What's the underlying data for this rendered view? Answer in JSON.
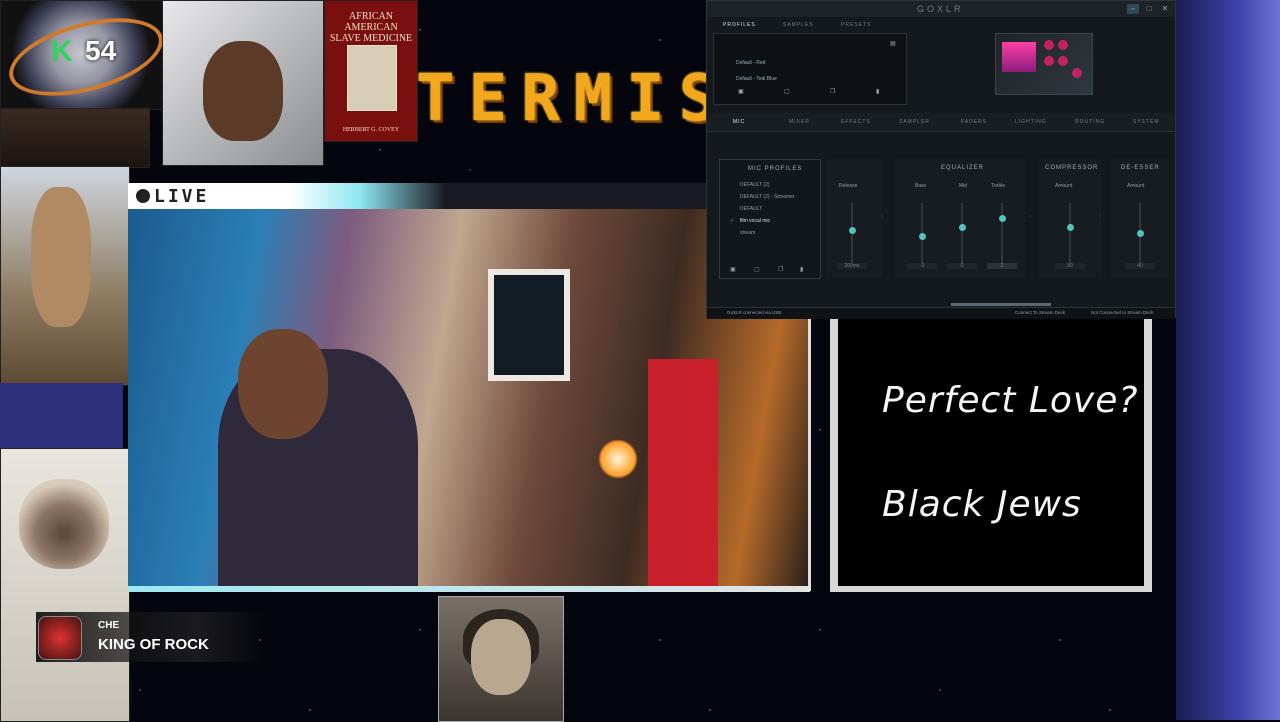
{
  "overlay": {
    "kick_letter": "K",
    "kick_count": "54",
    "ticker_text": "TERMIS",
    "live_label": "LIVE",
    "wall_line_1": "Perfect Love?",
    "wall_line_2": "Black Jews"
  },
  "book": {
    "title": "AFRICAN AMERICAN SLAVE MEDICINE",
    "author": "HERBERT G. COVEY"
  },
  "alert": {
    "user": "CHE",
    "message": "KING OF ROCK"
  },
  "goxlr": {
    "app_title": "GOXLR",
    "top_tabs": [
      "PROFILES",
      "SAMPLES",
      "PRESETS"
    ],
    "profiles": [
      "Default - Red",
      "Default - Teal Blue"
    ],
    "main_tabs": [
      "MIC",
      "MIXER",
      "EFFECTS",
      "SAMPLER",
      "FADERS",
      "LIGHTING",
      "ROUTING",
      "SYSTEM"
    ],
    "mic_profiles_title": "MIC PROFILES",
    "mic_profiles": [
      "DEFAULT (2)",
      "DEFAULT (2) - Streamer",
      "DEFAULT",
      "film vocal mic",
      "stream"
    ],
    "mic_selected_index": 3,
    "gate": {
      "label": "Release",
      "value": "200ms",
      "level": 0.55
    },
    "equalizer": {
      "title": "EQUALIZER",
      "bands": [
        {
          "label": "Bass",
          "value": "-3",
          "level": 0.45
        },
        {
          "label": "Mid",
          "value": "0",
          "level": 0.6
        },
        {
          "label": "Treble",
          "value": "2",
          "level": 0.75
        }
      ]
    },
    "compressor": {
      "title": "COMPRESSOR",
      "label": "Amount",
      "value": "50",
      "level": 0.6
    },
    "deesser": {
      "title": "DE-ESSER",
      "label": "Amount",
      "value": "40",
      "level": 0.5
    },
    "status_left": "GoXLR connected via USB",
    "status_mid": "Connect To Stream Deck",
    "status_right": "Not Connected to Stream Deck"
  }
}
